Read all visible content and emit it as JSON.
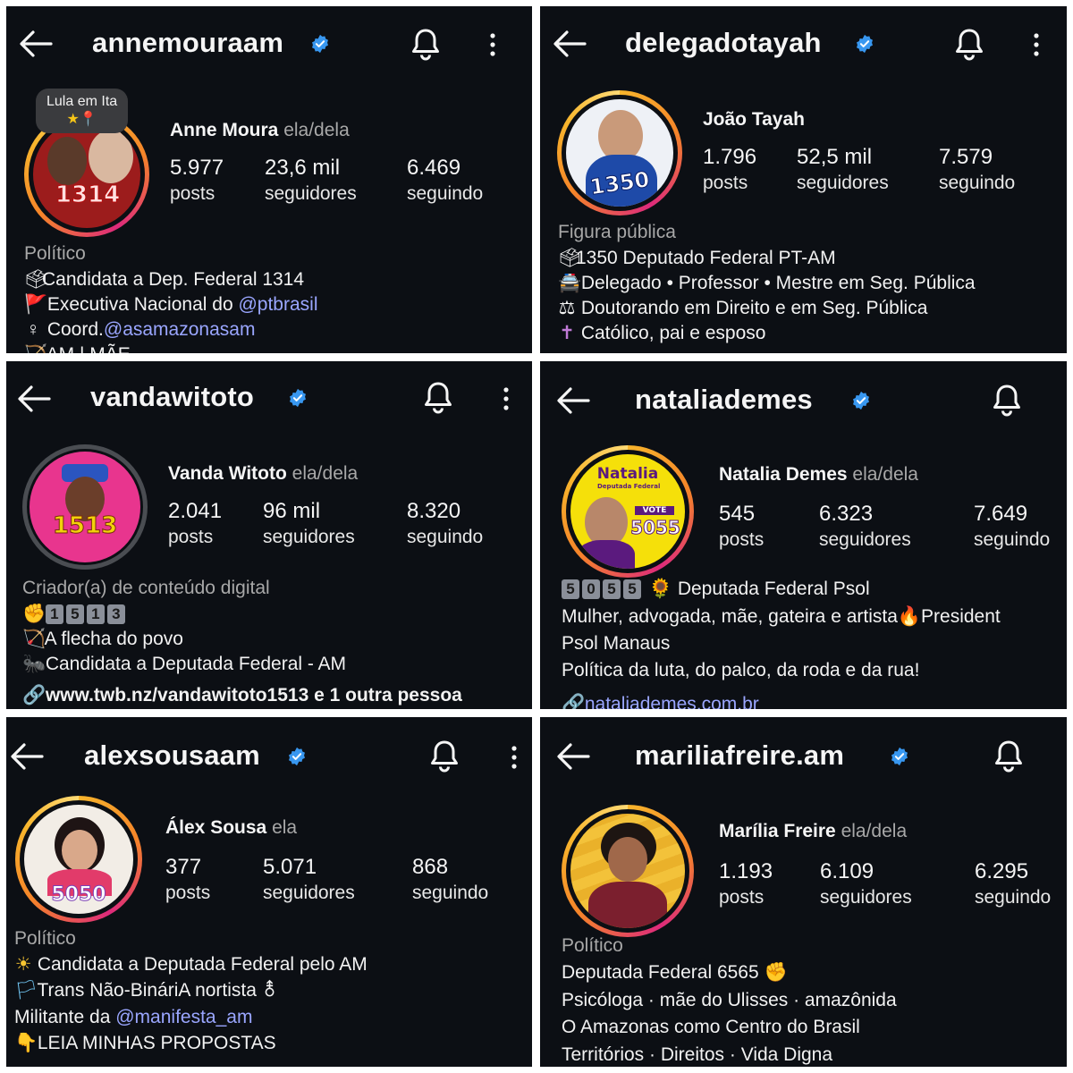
{
  "profiles": [
    {
      "username": "annemouraam",
      "display_name": "Anne Moura",
      "pronouns": "ela/dela",
      "tooltip": "Lula em Ita",
      "tooltip_emoji": "★📍",
      "avatar_badge": "1314",
      "stats": [
        {
          "value": "5.977",
          "label": "posts"
        },
        {
          "value": "23,6 mil",
          "label": "seguidores"
        },
        {
          "value": "6.469",
          "label": "seguindo"
        }
      ],
      "category": "Político",
      "bio": [
        {
          "emoji": "🗳",
          "text": "Candidata a Dep. Federal 1314",
          "mention": ""
        },
        {
          "emoji": "🚩",
          "text": " Executiva Nacional do ",
          "mention": "@ptbrasil"
        },
        {
          "emoji": "♀",
          "text": " Coord.",
          "mention": "@asamazonasam"
        },
        {
          "emoji": "🏹",
          "text": " AM | MÃE",
          "mention": ""
        }
      ]
    },
    {
      "username": "delegadotayah",
      "display_name": "João Tayah",
      "pronouns": "",
      "avatar_badge": "1350",
      "stats": [
        {
          "value": "1.796",
          "label": "posts"
        },
        {
          "value": "52,5 mil",
          "label": "seguidores"
        },
        {
          "value": "7.579",
          "label": "seguindo"
        }
      ],
      "category": "Figura pública",
      "bio": [
        {
          "emoji": "🗳",
          "text": "1350 Deputado Federal PT-AM"
        },
        {
          "emoji": "🚔",
          "text": " Delegado • Professor • Mestre em Seg. Pública"
        },
        {
          "emoji": "⚖",
          "text": " Doutorando em Direito e em Seg. Pública"
        },
        {
          "emoji": "✝",
          "text": " Católico, pai e esposo"
        }
      ]
    },
    {
      "username": "vandawitoto",
      "display_name": "Vanda Witoto",
      "pronouns": "ela/dela",
      "avatar_badge": "1513",
      "stats": [
        {
          "value": "2.041",
          "label": "posts"
        },
        {
          "value": "96 mil",
          "label": "seguidores"
        },
        {
          "value": "8.320",
          "label": "seguindo"
        }
      ],
      "category": "Criador(a) de conteúdo digital",
      "bio_keycaps_emoji": "✊",
      "bio_keycaps": [
        "1",
        "5",
        "1",
        "3"
      ],
      "bio": [
        {
          "emoji": "🏹",
          "text": " A flecha do povo"
        },
        {
          "emoji": "🐜",
          "text": " Candidata a Deputada Federal - AM"
        }
      ],
      "link_icon": "🔗",
      "link": "www.twb.nz/vandawitoto1513 e 1 outra pessoa"
    },
    {
      "username": "natalia demes",
      "display_name": "Natalia Demes",
      "pronouns": "ela/dela",
      "avatar_badge": "5055",
      "avatar_name": "Natalia",
      "avatar_sub": "Deputada Federal",
      "avatar_vote": "VOTE",
      "stats": [
        {
          "value": "545",
          "label": "posts"
        },
        {
          "value": "6.323",
          "label": "seguidores"
        },
        {
          "value": "7.649",
          "label": "seguindo"
        }
      ],
      "bio_keycaps": [
        "5",
        "0",
        "5",
        "5"
      ],
      "bio_keycaps_suffix": "🌻 Deputada Federal Psol",
      "bio": [
        {
          "text": "Mulher, advogada, mãe, gateira e artista🔥President"
        },
        {
          "text": "Psol Manaus"
        },
        {
          "text": "Política da luta, do palco, da roda e da rua!"
        }
      ],
      "link_icon": "🔗",
      "link": "nataliademes.com.br"
    },
    {
      "username": "alexsousaam",
      "display_name": "Álex Sousa",
      "pronouns": "ela",
      "avatar_badge": "5050",
      "stats": [
        {
          "value": "377",
          "label": "posts"
        },
        {
          "value": "5.071",
          "label": "seguidores"
        },
        {
          "value": "868",
          "label": "seguindo"
        }
      ],
      "category": "Político",
      "bio": [
        {
          "emoji": "☀",
          "text": " Candidata a Deputada Federal pelo AM",
          "mention": ""
        },
        {
          "emoji": "🏳",
          "text": " Trans Não-BináriA nortista ⚨",
          "mention": ""
        },
        {
          "emoji": "",
          "text": "Militante da ",
          "mention": "@manifesta_am"
        },
        {
          "emoji": "👇",
          "text": " LEIA MINHAS PROPOSTAS",
          "mention": ""
        }
      ]
    },
    {
      "username": "mariliafreire.am",
      "display_name": "Marília Freire",
      "pronouns": "ela/dela",
      "stats": [
        {
          "value": "1.193",
          "label": "posts"
        },
        {
          "value": "6.109",
          "label": "seguidores"
        },
        {
          "value": "6.295",
          "label": "seguindo"
        }
      ],
      "category": "Político",
      "bio": [
        {
          "text": "Deputada Federal 6565 ✊"
        },
        {
          "text": "Psicóloga · mãe do Ulisses · amazônida"
        },
        {
          "text": "O Amazonas como Centro do Brasil"
        },
        {
          "text": "Territórios · Direitos · Vida Digna"
        }
      ]
    }
  ],
  "colors": {
    "background": "#0c0f14",
    "verified": "#3897f0",
    "mention": "#9aa6ff",
    "secondary_text": "#a8a8a8"
  },
  "icons": {
    "back": "arrow-left-icon",
    "verified": "verified-badge-icon",
    "bell": "bell-icon",
    "more": "more-vertical-icon"
  }
}
